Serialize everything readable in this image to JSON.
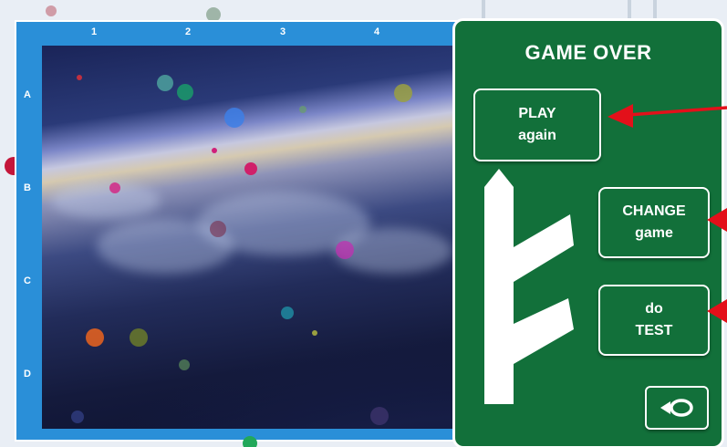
{
  "board": {
    "columns": [
      "1",
      "2",
      "3",
      "4"
    ],
    "rows": [
      "A",
      "B",
      "C",
      "D"
    ]
  },
  "panel": {
    "title": "GAME OVER",
    "play_button": {
      "line1": "PLAY",
      "line2": "again"
    },
    "change_button": {
      "line1": "CHANGE",
      "line2": "game"
    },
    "test_button": {
      "line1": "do",
      "line2": "TEST"
    },
    "horn_button_icon": "post-horn-icon",
    "rune_icon": "rune-icon"
  },
  "colors": {
    "board_blue": "#2a8fd8",
    "panel_green": "#12703a",
    "arrow_red": "#e3101a"
  }
}
